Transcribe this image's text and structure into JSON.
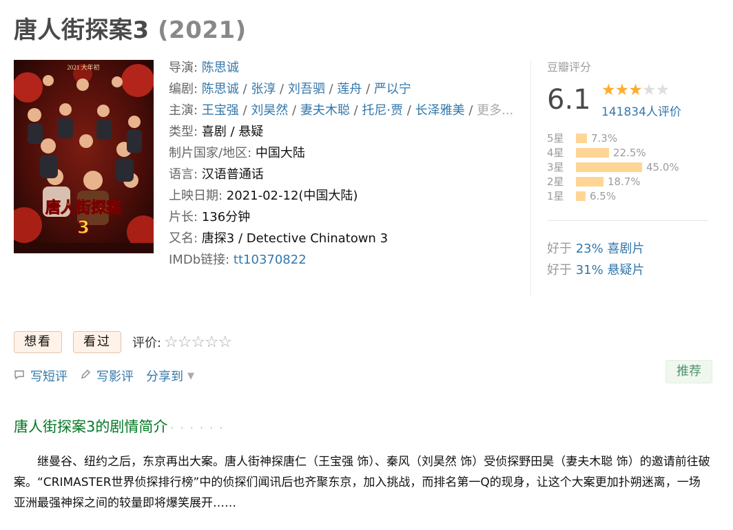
{
  "title": "唐人街探案3",
  "year": "(2021)",
  "info": {
    "director_label": "导演",
    "directors": [
      "陈思诚"
    ],
    "writer_label": "编剧",
    "writers": [
      "陈思诚",
      "张淳",
      "刘吾驷",
      "莲舟",
      "严以宁"
    ],
    "cast_label": "主演",
    "cast": [
      "王宝强",
      "刘昊然",
      "妻夫木聪",
      "托尼·贾",
      "长泽雅美"
    ],
    "more_label": "更多...",
    "genre_label": "类型",
    "genre": "喜剧 / 悬疑",
    "country_label": "制片国家/地区",
    "country": "中国大陆",
    "language_label": "语言",
    "language": "汉语普通话",
    "release_label": "上映日期",
    "release": "2021-02-12(中国大陆)",
    "runtime_label": "片长",
    "runtime": "136分钟",
    "aka_label": "又名",
    "aka": "唐探3 / Detective Chinatown 3",
    "imdb_label": "IMDb链接",
    "imdb": "tt10370822"
  },
  "poster": {
    "top_text": "2021 大年初",
    "logo_text": "唐人街探案",
    "number": "3"
  },
  "rating": {
    "label": "豆瓣评分",
    "score": "6.1",
    "stars_filled": 3,
    "stars_total": 5,
    "votes": "141834人评价",
    "histogram": [
      {
        "label": "5星",
        "percent": "7.3%",
        "value": 7.3
      },
      {
        "label": "4星",
        "percent": "22.5%",
        "value": 22.5
      },
      {
        "label": "3星",
        "percent": "45.0%",
        "value": 45.0
      },
      {
        "label": "2星",
        "percent": "18.7%",
        "value": 18.7
      },
      {
        "label": "1星",
        "percent": "6.5%",
        "value": 6.5
      }
    ],
    "better_than": [
      {
        "prefix": "好于 ",
        "link": "23% 喜剧片"
      },
      {
        "prefix": "好于 ",
        "link": "31% 悬疑片"
      }
    ]
  },
  "actions": {
    "want": "想看",
    "seen": "看过",
    "rate_label": "评价:",
    "rate_stars": "☆☆☆☆☆"
  },
  "links": {
    "short_review": "写短评",
    "review": "写影评",
    "share": "分享到"
  },
  "recommend": "推荐",
  "summary": {
    "heading": "唐人街探案3的剧情简介",
    "dots": "· · · · · ·",
    "text": "继曼谷、纽约之后，东京再出大案。唐人街神探唐仁（王宝强 饰）、秦风（刘昊然 饰）受侦探野田昊（妻夫木聪 饰）的邀请前往破案。“CRIMASTER世界侦探排行榜”中的侦探们闻讯后也齐聚东京，加入挑战，而排名第一Q的现身，让这个大案更加扑朔迷离，一场亚洲最强神探之间的较量即将爆笑展开……"
  },
  "colors": {
    "link": "#3377aa",
    "star": "#ffac2d",
    "bar": "#ffd596",
    "green_heading": "#007722"
  }
}
